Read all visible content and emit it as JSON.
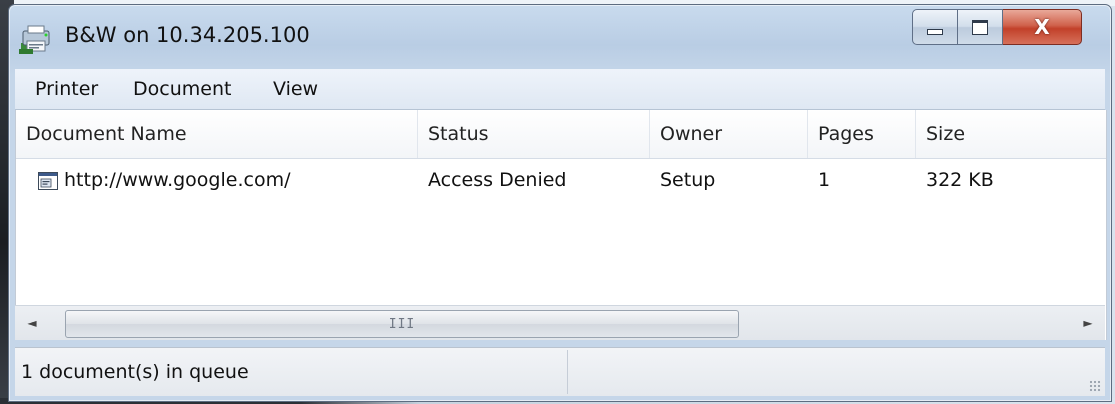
{
  "window": {
    "title": "B&W on 10.34.205.100",
    "icon": "printer-icon",
    "controls": {
      "minimize": "minimize-icon",
      "maximize": "maximize-icon",
      "close": "close-icon",
      "close_glyph": "X"
    }
  },
  "menu": {
    "items": [
      {
        "label": "Printer"
      },
      {
        "label": "Document"
      },
      {
        "label": "View"
      }
    ]
  },
  "list": {
    "columns": [
      "Document Name",
      "Status",
      "Owner",
      "Pages",
      "Size"
    ],
    "rows": [
      {
        "icon": "web-document-icon",
        "name": "http://www.google.com/",
        "status": "Access Denied",
        "owner": "Setup",
        "pages": "1",
        "size": "322 KB"
      }
    ]
  },
  "scrollbar": {
    "left_arrow": "◄",
    "right_arrow": "►",
    "grip": "III"
  },
  "status": {
    "text": "1 document(s) in queue"
  },
  "colors": {
    "close_button": "#c2412a",
    "title_bar": "#b9cde4",
    "menubar": "#eef3fa"
  }
}
